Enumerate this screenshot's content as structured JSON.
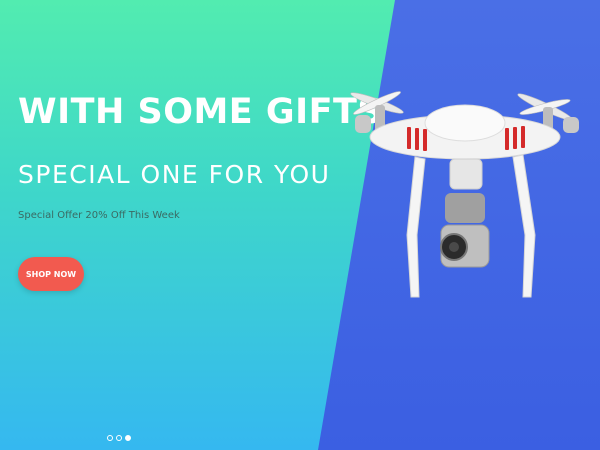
{
  "hero": {
    "headline": "WITH SOME GIFTS",
    "subheadline": "SPECIAL ONE FOR YOU",
    "offer_text": "Special Offer 20% Off This Week",
    "button_label": "SHOP NOW",
    "slides": {
      "count": 3,
      "active_index": 2
    }
  },
  "colors": {
    "left_gradient_top": "#52ecb0",
    "left_gradient_bottom": "#35b8f0",
    "right_panel": "#3b5fe2",
    "button": "#f25a4f",
    "drone_accent": "#d42a2a"
  },
  "icons": [
    "drone-image",
    "carousel-dot"
  ]
}
